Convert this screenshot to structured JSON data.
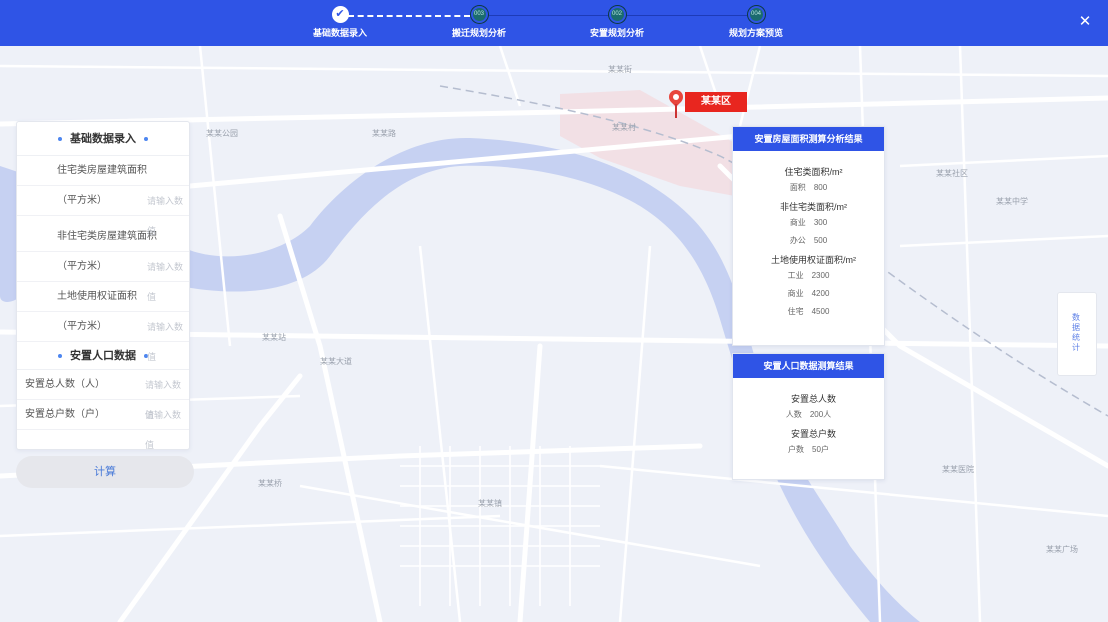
{
  "steps": [
    {
      "label": "基础数据录入",
      "icon": "✔",
      "done": true
    },
    {
      "label": "搬迁规划分析",
      "icon": "003",
      "done": false
    },
    {
      "label": "安置规划分析",
      "icon": "002",
      "done": false
    },
    {
      "label": "规划方案预览",
      "icon": "004",
      "done": false
    }
  ],
  "close_icon": "✕",
  "marker": {
    "label": "某某区"
  },
  "form": {
    "header": "基础数据录入",
    "rows": [
      {
        "label": "住宅类房屋建筑面积",
        "field": "（平方米）",
        "placeholder": "请输入数值"
      },
      {
        "label": "非住宅类房屋建筑面积",
        "field": "（平方米）",
        "placeholder": "请输入数值"
      },
      {
        "label": "土地使用权证面积",
        "field": "（平方米）",
        "placeholder": "请输入数值"
      }
    ],
    "section2": "安置人口数据",
    "population": [
      {
        "label": "安置总人数（人）",
        "placeholder": "请输入数值"
      },
      {
        "label": "安置总户数（户）",
        "placeholder": "请输入数值"
      }
    ],
    "button": "计算"
  },
  "card1": {
    "title": "安置房屋面积测算分析结果",
    "groups": [
      {
        "title": "住宅类面积/m²",
        "lines": [
          [
            "面积",
            "800"
          ]
        ]
      },
      {
        "title": "非住宅类面积/m²",
        "lines": [
          [
            "商业",
            "300"
          ],
          [
            "办公",
            "500"
          ]
        ]
      },
      {
        "title": "土地使用权证面积/m²",
        "lines": [
          [
            "工业",
            "2300"
          ],
          [
            "商业",
            "4200"
          ],
          [
            "住宅",
            "4500"
          ]
        ]
      }
    ]
  },
  "card2": {
    "title": "安置人口数据测算结果",
    "groups": [
      {
        "title": "安置总人数",
        "lines": [
          [
            "人数",
            "200人"
          ]
        ]
      },
      {
        "title": "安置总户数",
        "lines": [
          [
            "户数",
            "50户"
          ]
        ]
      }
    ]
  },
  "edge_tab": "数据统计",
  "map_labels": [
    {
      "id": "l1",
      "text": "某某公园"
    },
    {
      "id": "l2",
      "text": "某某路"
    },
    {
      "id": "l3",
      "text": "某某街"
    },
    {
      "id": "l4",
      "text": "某某村"
    },
    {
      "id": "l5",
      "text": "某某站"
    },
    {
      "id": "l6",
      "text": "某某大道"
    },
    {
      "id": "l7",
      "text": "某某桥"
    },
    {
      "id": "l8",
      "text": "某某镇"
    },
    {
      "id": "l9",
      "text": "某某社区"
    },
    {
      "id": "l10",
      "text": "某某中学"
    },
    {
      "id": "l11",
      "text": "某某医院"
    },
    {
      "id": "l12",
      "text": "某某广场"
    }
  ],
  "colors": {
    "primary": "#2f54e6",
    "accent_red": "#e8261f",
    "river": "#c6d1f2",
    "road": "#ffffff"
  }
}
